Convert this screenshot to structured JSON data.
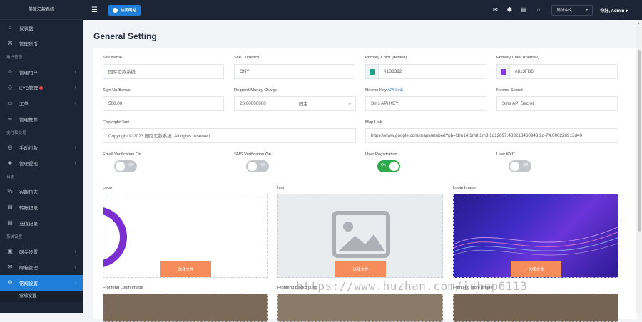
{
  "sidebar": {
    "brand": "美联汇款系统",
    "items": [
      {
        "label": "仪表盘",
        "icon": "home-icon"
      },
      {
        "label": "管理货币",
        "icon": "command-icon"
      },
      {
        "section": "用户管理"
      },
      {
        "label": "管理用户",
        "icon": "user-icon",
        "chevron": true
      },
      {
        "label": "KYC管理",
        "icon": "shield-icon",
        "chevron": true,
        "dot": true
      },
      {
        "label": "工单",
        "icon": "ticket-icon",
        "chevron": true
      },
      {
        "label": "管理推荐",
        "icon": "link-icon"
      },
      {
        "section": "支付和交易"
      },
      {
        "label": "手动付款",
        "icon": "pay-icon",
        "chevron": true
      },
      {
        "label": "管理提现",
        "icon": "cube-icon",
        "chevron": true
      },
      {
        "section": "日志"
      },
      {
        "label": "兴趣日志",
        "icon": "percent-icon"
      },
      {
        "label": "转账记录",
        "icon": "file-icon"
      },
      {
        "label": "充值记录",
        "icon": "file-icon"
      },
      {
        "section": "系统设置"
      },
      {
        "label": "网关设置",
        "icon": "wallet-icon",
        "chevron": true
      },
      {
        "label": "邮箱管理",
        "icon": "mail-icon",
        "chevron": true
      },
      {
        "label": "常规设置",
        "icon": "gear-icon",
        "chevron": true,
        "active": true
      }
    ],
    "sub_active": "常规设置"
  },
  "topbar": {
    "visit_label": "访问网站",
    "language": "简体中文",
    "admin": "你好, Admin"
  },
  "page": {
    "title": "General Setting"
  },
  "form": {
    "site_name_label": "Site Name",
    "site_name": "国际汇款系统",
    "site_currency_label": "Site Currency",
    "site_currency": "CNY",
    "primary_default_label": "Primary Color (default)",
    "primary_default": "#1B8392",
    "primary_default_swatch": "#1fa086",
    "primary_theme2_label": "Primary Color (theme2)",
    "primary_theme2": "#813FD6",
    "primary_theme2_swatch": "#813fd6",
    "signup_bonus_label": "Sign Up Bonus",
    "signup_bonus": "500.00",
    "request_money_label": "Request Money Charge",
    "request_money": "20.00000000",
    "request_money_type": "固定",
    "nexmo_key_label": "Nexmo Key",
    "nexmo_key_link": "API Link",
    "nexmo_key_placeholder": "Sms API KEY",
    "nexmo_secret_label": "Nexmo Secret",
    "nexmo_secret_placeholder": "Sms API Secret",
    "copyright_label": "Copyright Text",
    "copyright": "Copyright © 2023 国际汇款系统. All rights reserved.",
    "map_link_label": "Map Link",
    "map_link": "https://www.google.com/maps/embed?pb=!1m14!1m8!1m3!1d12097.433213460943!2d-74.006226913d40",
    "email_verif_label": "Email Verification On",
    "email_verif": "Off",
    "sms_verif_label": "SMS Verification On",
    "sms_verif": "Off",
    "user_reg_label": "User Registration",
    "user_reg": "On",
    "user_kyc_label": "User KYC",
    "user_kyc": "Off",
    "logo_label": "Logo",
    "icon_label": "Icon",
    "login_image_label": "Login Image",
    "frontend_login_label": "Frontend Login Image",
    "frontend_bg_label": "Frontend Background",
    "frontend_more_label": "Frontend More Image",
    "upload_label": "选择文件"
  },
  "colors": {
    "sidebar_bg": "#1c2535",
    "accent": "#1f7fd8",
    "upload_btn": "#f68c5a",
    "toggle_on": "#2fa94b"
  },
  "watermark": "https://www.huzhan.com/ishop6113"
}
